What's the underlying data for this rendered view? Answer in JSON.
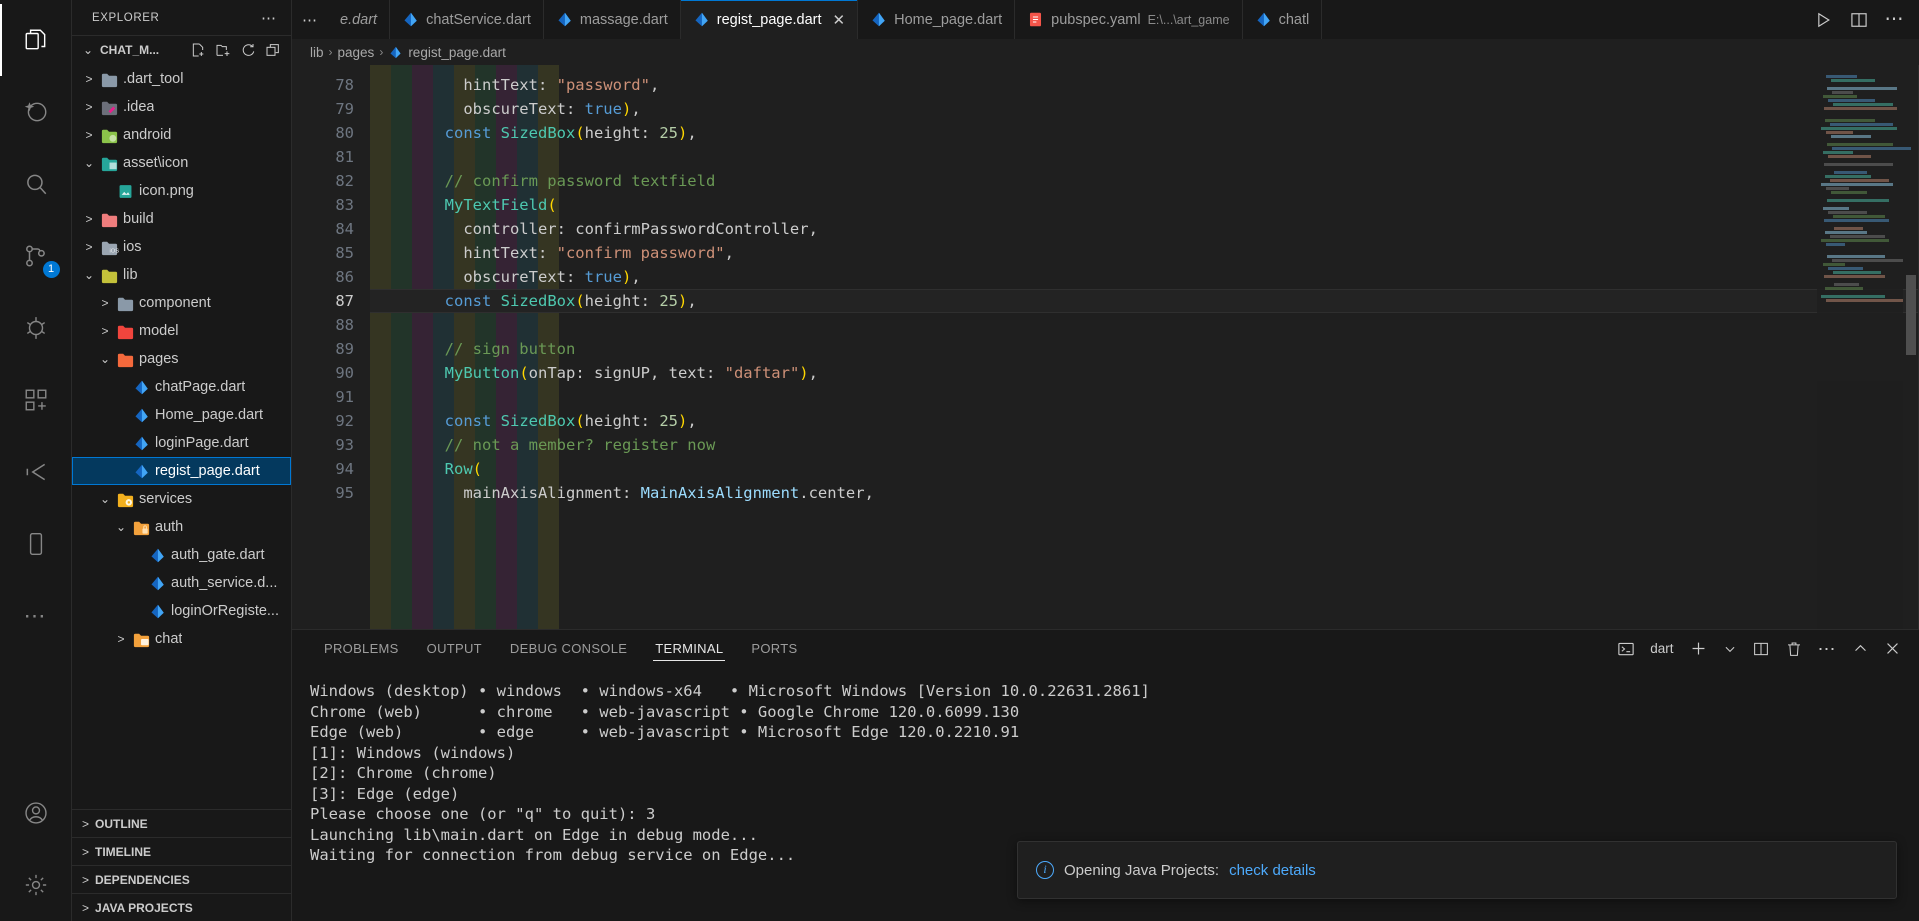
{
  "activity_bar": {
    "items": [
      {
        "name": "explorer",
        "icon": "files-icon",
        "active": true,
        "badge": null
      },
      {
        "name": "source-control-graph",
        "icon": "sparkle-icon",
        "active": false,
        "badge": null
      },
      {
        "name": "search",
        "icon": "search-icon",
        "active": false,
        "badge": null
      },
      {
        "name": "source-control",
        "icon": "source-control-icon",
        "active": false,
        "badge": "1"
      },
      {
        "name": "run-and-debug",
        "icon": "run-debug-icon",
        "active": false,
        "badge": null
      },
      {
        "name": "extensions",
        "icon": "extensions-icon",
        "active": false,
        "badge": null
      },
      {
        "name": "testing",
        "icon": "beaker-icon",
        "active": false,
        "badge": null
      },
      {
        "name": "mobile-preview",
        "icon": "device-icon",
        "active": false,
        "badge": null
      },
      {
        "name": "more-views",
        "icon": "ellipsis-icon",
        "active": false,
        "badge": null
      }
    ],
    "bottom_items": [
      {
        "name": "accounts",
        "icon": "account-icon"
      },
      {
        "name": "manage-settings",
        "icon": "gear-icon"
      }
    ]
  },
  "sidebar": {
    "title": "EXPLORER",
    "more_actions": "⋯",
    "project": {
      "label": "CHAT_M...",
      "chevron": "⌄",
      "actions": [
        "new-file-icon",
        "new-folder-icon",
        "refresh-icon",
        "collapse-all-icon"
      ]
    },
    "tree": [
      {
        "label": ".dart_tool",
        "depth": 1,
        "twisty": ">",
        "kind": "folder",
        "color": "#8a99a8",
        "selected": false
      },
      {
        "label": ".idea",
        "depth": 1,
        "twisty": ">",
        "kind": "folder-idea",
        "color": "#6c6f7a",
        "selected": false
      },
      {
        "label": "android",
        "depth": 1,
        "twisty": ">",
        "kind": "folder-android",
        "color": "#8bc34a",
        "selected": false
      },
      {
        "label": "asset\\icon",
        "depth": 1,
        "twisty": "⌄",
        "kind": "folder-image",
        "color": "#26a69a",
        "selected": false
      },
      {
        "label": "icon.png",
        "depth": 2,
        "twisty": "",
        "kind": "image-file",
        "color": "#26a69a",
        "selected": false
      },
      {
        "label": "build",
        "depth": 1,
        "twisty": ">",
        "kind": "folder",
        "color": "#ef7d7d",
        "selected": false
      },
      {
        "label": "ios",
        "depth": 1,
        "twisty": ">",
        "kind": "folder-ios",
        "color": "#9aa5b1",
        "selected": false
      },
      {
        "label": "lib",
        "depth": 1,
        "twisty": "⌄",
        "kind": "folder",
        "color": "#c3c13a",
        "selected": false
      },
      {
        "label": "component",
        "depth": 2,
        "twisty": ">",
        "kind": "folder",
        "color": "#8a99a8",
        "selected": false
      },
      {
        "label": "model",
        "depth": 2,
        "twisty": ">",
        "kind": "folder",
        "color": "#f1453d",
        "selected": false
      },
      {
        "label": "pages",
        "depth": 2,
        "twisty": "⌄",
        "kind": "folder",
        "color": "#f4693c",
        "selected": false
      },
      {
        "label": "chatPage.dart",
        "depth": 3,
        "twisty": "",
        "kind": "dart-file",
        "color": "#2196f3",
        "selected": false
      },
      {
        "label": "Home_page.dart",
        "depth": 3,
        "twisty": "",
        "kind": "dart-file",
        "color": "#2196f3",
        "selected": false
      },
      {
        "label": "loginPage.dart",
        "depth": 3,
        "twisty": "",
        "kind": "dart-file",
        "color": "#2196f3",
        "selected": false
      },
      {
        "label": "regist_page.dart",
        "depth": 3,
        "twisty": "",
        "kind": "dart-file",
        "color": "#2196f3",
        "selected": true
      },
      {
        "label": "services",
        "depth": 2,
        "twisty": "⌄",
        "kind": "folder-gear",
        "color": "#f2b01e",
        "selected": false
      },
      {
        "label": "auth",
        "depth": 3,
        "twisty": "⌄",
        "kind": "folder-lock",
        "color": "#f2a13c",
        "selected": false
      },
      {
        "label": "auth_gate.dart",
        "depth": 4,
        "twisty": "",
        "kind": "dart-file",
        "color": "#2196f3",
        "selected": false
      },
      {
        "label": "auth_service.d...",
        "depth": 4,
        "twisty": "",
        "kind": "dart-file",
        "color": "#2196f3",
        "selected": false
      },
      {
        "label": "loginOrRegiste...",
        "depth": 4,
        "twisty": "",
        "kind": "dart-file",
        "color": "#2196f3",
        "selected": false
      },
      {
        "label": "chat",
        "depth": 3,
        "twisty": ">",
        "kind": "folder-chat",
        "color": "#f2a13c",
        "selected": false
      }
    ],
    "bottom_sections": [
      {
        "label": "OUTLINE",
        "chevron": ">"
      },
      {
        "label": "TIMELINE",
        "chevron": ">"
      },
      {
        "label": "DEPENDENCIES",
        "chevron": ">"
      },
      {
        "label": "JAVA PROJECTS",
        "chevron": ">"
      }
    ]
  },
  "tabs": {
    "overflow_indicator": "⋯",
    "items": [
      {
        "label": "e.dart",
        "icon": "none",
        "active": false,
        "dirty": true,
        "desc": "",
        "close": false,
        "truncated": true
      },
      {
        "label": "chatService.dart",
        "icon": "dart-icon",
        "active": false,
        "dirty": false,
        "desc": "",
        "close": false
      },
      {
        "label": "massage.dart",
        "icon": "dart-icon",
        "active": false,
        "dirty": false,
        "desc": "",
        "close": false
      },
      {
        "label": "regist_page.dart",
        "icon": "dart-icon",
        "active": true,
        "dirty": false,
        "desc": "",
        "close": true
      },
      {
        "label": "Home_page.dart",
        "icon": "dart-icon",
        "active": false,
        "dirty": false,
        "desc": "",
        "close": false
      },
      {
        "label": "pubspec.yaml",
        "icon": "yaml-icon",
        "active": false,
        "dirty": false,
        "desc": "E:\\...\\art_game",
        "close": false
      },
      {
        "label": "chatl",
        "icon": "dart-icon",
        "active": false,
        "dirty": false,
        "desc": "",
        "close": false,
        "truncated": true
      }
    ],
    "actions": [
      {
        "name": "run-button",
        "icon": "play-icon"
      },
      {
        "name": "split-editor-button",
        "icon": "split-icon"
      },
      {
        "name": "more-actions-button",
        "icon": "ellipsis-icon"
      }
    ]
  },
  "breadcrumbs": {
    "items": [
      "lib",
      "pages",
      "regist_page.dart"
    ],
    "separator": "›"
  },
  "editor": {
    "first_line_number": 78,
    "active_line": 87,
    "lines": [
      {
        "n": 78,
        "tokens": [
          {
            "t": "          hintText: ",
            "c": "pl"
          },
          {
            "t": "\"password\"",
            "c": "str"
          },
          {
            "t": ",",
            "c": "pl"
          }
        ]
      },
      {
        "n": 79,
        "tokens": [
          {
            "t": "          obscureText: ",
            "c": "pl"
          },
          {
            "t": "true",
            "c": "kw"
          },
          {
            "t": ")",
            "c": "par"
          },
          {
            "t": ",",
            "c": "pl"
          }
        ]
      },
      {
        "n": 80,
        "tokens": [
          {
            "t": "        ",
            "c": "pl"
          },
          {
            "t": "const",
            "c": "kw"
          },
          {
            "t": " ",
            "c": "pl"
          },
          {
            "t": "SizedBox",
            "c": "type"
          },
          {
            "t": "(",
            "c": "par"
          },
          {
            "t": "height: ",
            "c": "pl"
          },
          {
            "t": "25",
            "c": "num"
          },
          {
            "t": ")",
            "c": "par"
          },
          {
            "t": ",",
            "c": "pl"
          }
        ]
      },
      {
        "n": 81,
        "tokens": []
      },
      {
        "n": 82,
        "tokens": [
          {
            "t": "        // confirm password textfield",
            "c": "cmt"
          }
        ]
      },
      {
        "n": 83,
        "tokens": [
          {
            "t": "        ",
            "c": "pl"
          },
          {
            "t": "MyTextField",
            "c": "type"
          },
          {
            "t": "(",
            "c": "par"
          }
        ]
      },
      {
        "n": 84,
        "tokens": [
          {
            "t": "          controller: confirmPasswordController,",
            "c": "pl"
          }
        ]
      },
      {
        "n": 85,
        "tokens": [
          {
            "t": "          hintText: ",
            "c": "pl"
          },
          {
            "t": "\"confirm password\"",
            "c": "str"
          },
          {
            "t": ",",
            "c": "pl"
          }
        ]
      },
      {
        "n": 86,
        "tokens": [
          {
            "t": "          obscureText: ",
            "c": "pl"
          },
          {
            "t": "true",
            "c": "kw"
          },
          {
            "t": ")",
            "c": "par"
          },
          {
            "t": ",",
            "c": "pl"
          }
        ]
      },
      {
        "n": 87,
        "tokens": [
          {
            "t": "        ",
            "c": "pl"
          },
          {
            "t": "const",
            "c": "kw"
          },
          {
            "t": " ",
            "c": "pl"
          },
          {
            "t": "SizedBox",
            "c": "type"
          },
          {
            "t": "(",
            "c": "par"
          },
          {
            "t": "height: ",
            "c": "pl"
          },
          {
            "t": "25",
            "c": "num"
          },
          {
            "t": ")",
            "c": "par"
          },
          {
            "t": ",",
            "c": "pl"
          }
        ]
      },
      {
        "n": 88,
        "tokens": []
      },
      {
        "n": 89,
        "tokens": [
          {
            "t": "        // sign button",
            "c": "cmt"
          }
        ]
      },
      {
        "n": 90,
        "tokens": [
          {
            "t": "        ",
            "c": "pl"
          },
          {
            "t": "MyButton",
            "c": "type"
          },
          {
            "t": "(",
            "c": "par"
          },
          {
            "t": "onTap: signUP, text: ",
            "c": "pl"
          },
          {
            "t": "\"daftar\"",
            "c": "str"
          },
          {
            "t": ")",
            "c": "par"
          },
          {
            "t": ",",
            "c": "pl"
          }
        ]
      },
      {
        "n": 91,
        "tokens": []
      },
      {
        "n": 92,
        "tokens": [
          {
            "t": "        ",
            "c": "pl"
          },
          {
            "t": "const",
            "c": "kw"
          },
          {
            "t": " ",
            "c": "pl"
          },
          {
            "t": "SizedBox",
            "c": "type"
          },
          {
            "t": "(",
            "c": "par"
          },
          {
            "t": "height: ",
            "c": "pl"
          },
          {
            "t": "25",
            "c": "num"
          },
          {
            "t": ")",
            "c": "par"
          },
          {
            "t": ",",
            "c": "pl"
          }
        ]
      },
      {
        "n": 93,
        "tokens": [
          {
            "t": "        // not a member? register now",
            "c": "cmt"
          }
        ]
      },
      {
        "n": 94,
        "tokens": [
          {
            "t": "        ",
            "c": "pl"
          },
          {
            "t": "Row",
            "c": "type"
          },
          {
            "t": "(",
            "c": "par"
          }
        ]
      },
      {
        "n": 95,
        "tokens": [
          {
            "t": "          mainAxisAlignment: ",
            "c": "pl"
          },
          {
            "t": "MainAxisAlignment",
            "c": "var"
          },
          {
            "t": ".center,",
            "c": "pl"
          }
        ]
      }
    ]
  },
  "panel": {
    "tabs": [
      {
        "label": "PROBLEMS",
        "active": false
      },
      {
        "label": "OUTPUT",
        "active": false
      },
      {
        "label": "DEBUG CONSOLE",
        "active": false
      },
      {
        "label": "TERMINAL",
        "active": true
      },
      {
        "label": "PORTS",
        "active": false
      }
    ],
    "actions": {
      "shell_label": "dart",
      "buttons": [
        {
          "name": "terminal-shell-icon",
          "icon": "terminal-icon"
        },
        {
          "name": "new-terminal-button",
          "icon": "plus-icon"
        },
        {
          "name": "terminal-dropdown-button",
          "icon": "chevron-down-icon"
        },
        {
          "name": "split-terminal-button",
          "icon": "split-icon"
        },
        {
          "name": "kill-terminal-button",
          "icon": "trash-icon"
        },
        {
          "name": "panel-more-button",
          "icon": "ellipsis-icon"
        },
        {
          "name": "maximize-panel-button",
          "icon": "chevron-up-icon"
        },
        {
          "name": "close-panel-button",
          "icon": "close-icon"
        }
      ]
    },
    "terminal_lines": [
      "Windows (desktop) • windows  • windows-x64   • Microsoft Windows [Version 10.0.22631.2861]",
      "Chrome (web)      • chrome   • web-javascript • Google Chrome 120.0.6099.130",
      "Edge (web)        • edge     • web-javascript • Microsoft Edge 120.0.2210.91",
      "[1]: Windows (windows)",
      "[2]: Chrome (chrome)",
      "[3]: Edge (edge)",
      "Please choose one (or \"q\" to quit): 3",
      "Launching lib\\main.dart on Edge in debug mode...",
      "Waiting for connection from debug service on Edge..."
    ]
  },
  "notification": {
    "icon": "info-icon",
    "text": "Opening Java Projects:",
    "link": "check details"
  },
  "colors": {
    "accent": "#0078d4",
    "selection": "#04395e",
    "link": "#4daafc",
    "editor_bg": "#1f1f1f",
    "sidebar_bg": "#181818",
    "dart_blue": "#2196f3"
  }
}
